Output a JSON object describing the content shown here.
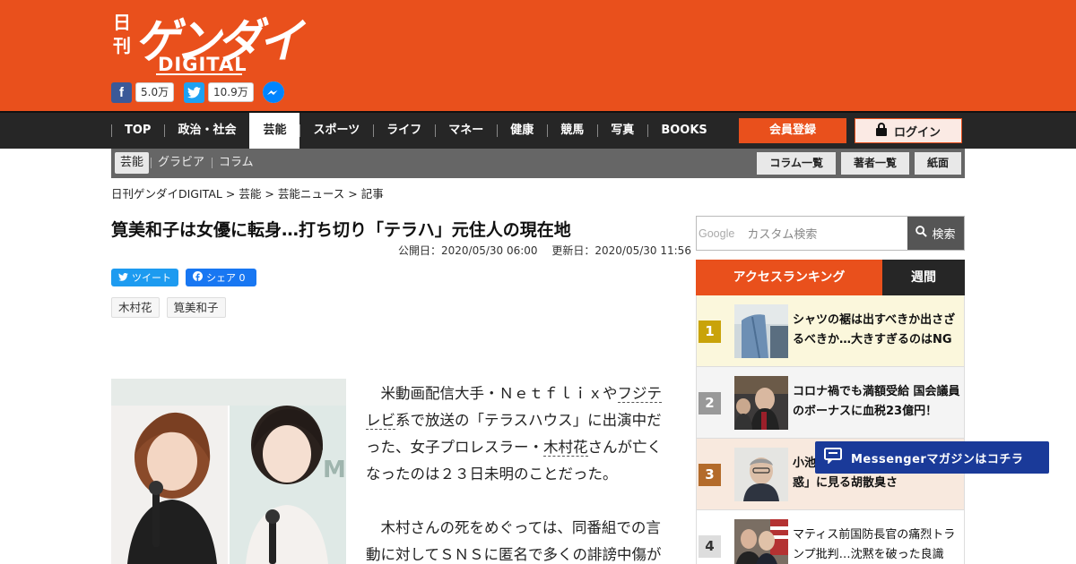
{
  "header": {
    "logo": {
      "nikkan": "日刊",
      "gendai": "ゲンダイ",
      "digital": "DIGITAL"
    },
    "social": {
      "facebook_count": "5.0万",
      "twitter_count": "10.9万"
    }
  },
  "nav": {
    "items": [
      {
        "label": "TOP"
      },
      {
        "label": "政治・社会"
      },
      {
        "label": "芸能",
        "active": true
      },
      {
        "label": "スポーツ"
      },
      {
        "label": "ライフ"
      },
      {
        "label": "マネー"
      },
      {
        "label": "健康"
      },
      {
        "label": "競馬"
      },
      {
        "label": "写真"
      },
      {
        "label": "BOOKS"
      }
    ],
    "register_label": "会員登録",
    "login_label": "ログイン"
  },
  "subnav": {
    "items": [
      {
        "label": "芸能",
        "active": true
      },
      {
        "label": "グラビア"
      },
      {
        "label": "コラム"
      }
    ],
    "buttons": [
      "コラム一覧",
      "著者一覧",
      "紙面"
    ]
  },
  "breadcrumb": [
    "日刊ゲンダイDIGITAL",
    "芸能",
    "芸能ニュース",
    "記事"
  ],
  "article": {
    "title": "筧美和子は女優に転身…打ち切り「テラハ」元住人の現在地",
    "published": "公開日：2020/05/30 06:00",
    "updated": "更新日：2020/05/30 11:56",
    "share": {
      "tweet_label": "ツイート",
      "fb_label": "シェア 0"
    },
    "tags": [
      "木村花",
      "筧美和子"
    ],
    "body": {
      "p1_a": "米動画配信大手・Ｎｅｔｆｌｉｘや",
      "p1_kw1": "フジテレビ",
      "p1_b": "系で放送の「テラスハウス」に出演中だった、女子プロレスラー・",
      "p1_kw2": "木村花",
      "p1_c": "さんが亡くなったのは２３日未明のことだった。",
      "p2": "木村さんの死をめぐっては、同番組での言動に対してＳＮＳに匿名で多くの誹謗中傷が"
    }
  },
  "sidebar": {
    "search": {
      "google_label": "Google",
      "placeholder": "カスタム検索",
      "button_label": "検索"
    },
    "ranking": {
      "tab_main": "アクセスランキング",
      "tab_week": "週間",
      "items": [
        {
          "rank": "1",
          "title": "シャツの裾は出すべきか出さざるべきか…大きすぎるのはNG"
        },
        {
          "rank": "2",
          "title": "コロナ禍でも満額受給 国会議員のボーナスに血税23億円！"
        },
        {
          "rank": "3",
          "title": "小池　　　　　　　　　　　　　惑」に見る胡散臭さ"
        },
        {
          "rank": "4",
          "title": "マティス前国防長官の痛烈トランプ批判…沈黙を破った良識"
        }
      ]
    },
    "messenger_banner": "Messengerマガジンはコチラ"
  },
  "colors": {
    "brand": "#e9501c",
    "nav_bg": "#262626",
    "messenger": "#1a3a99"
  }
}
